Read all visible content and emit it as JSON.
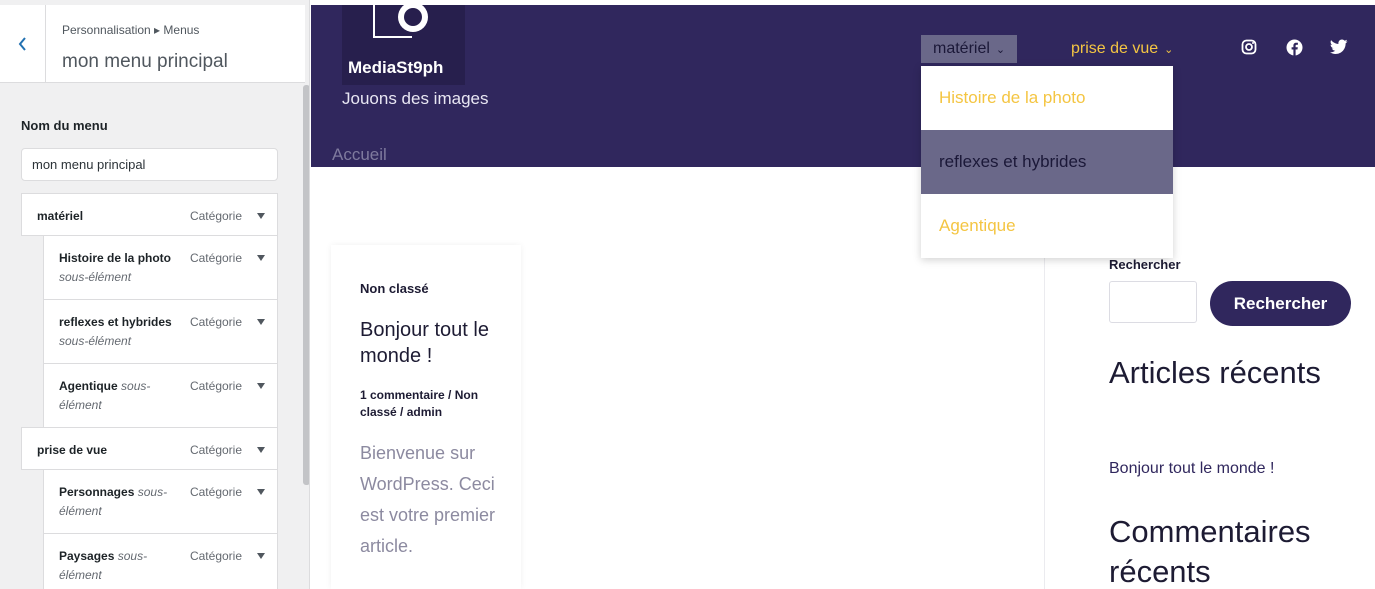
{
  "sidebar": {
    "breadcrumb": "Personnalisation ▸ Menus",
    "title": "mon menu principal",
    "name_label": "Nom du menu",
    "name_value": "mon menu principal",
    "items": [
      {
        "title": "matériel",
        "sub": "",
        "type": "Catégorie"
      },
      {
        "title": "Histoire de la photo",
        "sub": "sous-élément",
        "type": "Catégorie"
      },
      {
        "title": "reflexes et hybrides",
        "sub": "sous-élément",
        "type": "Catégorie"
      },
      {
        "title": "Agentique",
        "sub": "sous-élément",
        "type": "Catégorie"
      },
      {
        "title": "prise de vue",
        "sub": "",
        "type": "Catégorie"
      },
      {
        "title": "Personnages",
        "sub": "sous-élément",
        "type": "Catégorie"
      },
      {
        "title": "Paysages",
        "sub": "sous-élément",
        "type": "Catégorie"
      }
    ]
  },
  "site": {
    "title": "MediaSt9ph",
    "tagline": "Jouons des images",
    "home_link": "Accueil",
    "nav": {
      "materiel": "matériel",
      "prise_de_vue": "prise de vue",
      "dropdown": [
        "Histoire de la photo",
        "reflexes et hybrides",
        "Agentique"
      ]
    },
    "social_icons": [
      "instagram-icon",
      "facebook-icon",
      "twitter-icon"
    ]
  },
  "post": {
    "category": "Non classé",
    "title": "Bonjour tout le monde !",
    "meta": "1 commentaire / Non classé / admin",
    "excerpt": "Bienvenue sur WordPress. Ceci est votre premier article."
  },
  "widgets": {
    "search_label": "Rechercher",
    "search_button": "Rechercher",
    "recent_posts_heading": "Articles récents",
    "recent_post_link": "Bonjour tout le monde !",
    "recent_comments_heading": "Commentaires récents"
  },
  "colors": {
    "header_bg": "#30275d",
    "accent_yellow": "#f4c542",
    "active_nav": "#6a6889"
  }
}
